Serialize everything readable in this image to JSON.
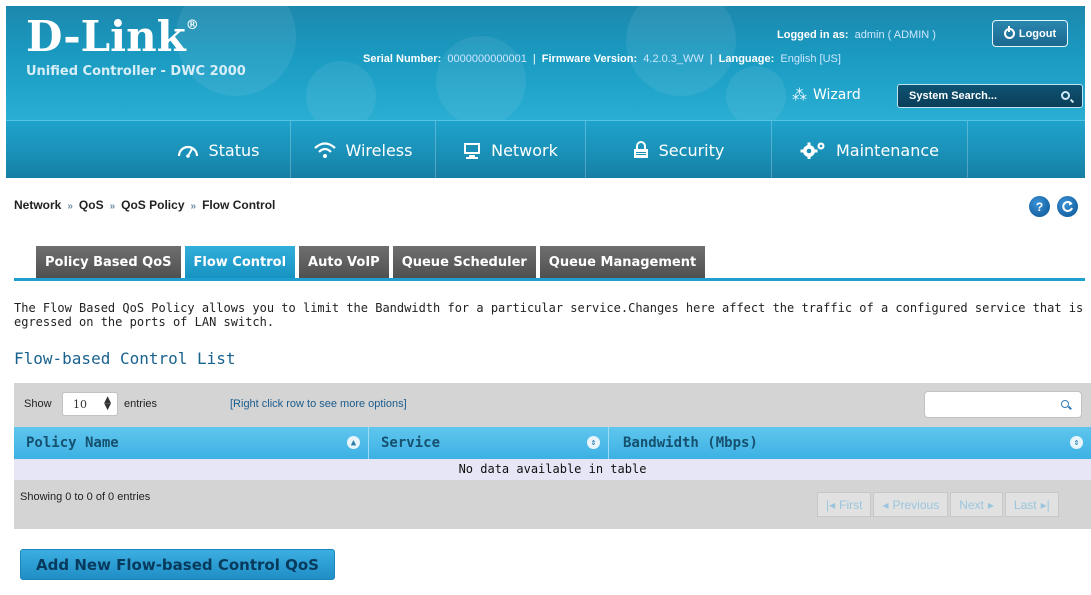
{
  "header": {
    "logo": "D-Link",
    "logo_mark": "®",
    "subtitle": "Unified Controller - DWC 2000",
    "logged_in_label": "Logged in as:",
    "logged_in_value": "admin ( ADMIN )",
    "logout_label": "Logout",
    "serial_label": "Serial Number:",
    "serial_value": "0000000000001",
    "firmware_label": "Firmware Version:",
    "firmware_value": "4.2.0.3_WW",
    "language_label": "Language:",
    "language_value": "English [US]",
    "wizard_label": "Wizard",
    "search_placeholder": "System Search..."
  },
  "nav": {
    "items": [
      {
        "label": "Status",
        "icon": "speedometer-icon"
      },
      {
        "label": "Wireless",
        "icon": "wifi-icon"
      },
      {
        "label": "Network",
        "icon": "monitor-icon"
      },
      {
        "label": "Security",
        "icon": "lock-icon"
      },
      {
        "label": "Maintenance",
        "icon": "gears-icon"
      }
    ]
  },
  "breadcrumb": {
    "items": [
      "Network",
      "QoS",
      "QoS Policy",
      "Flow Control"
    ],
    "separator": "»"
  },
  "tabs": [
    {
      "label": "Policy Based QoS",
      "active": false
    },
    {
      "label": "Flow Control",
      "active": true
    },
    {
      "label": "Auto VoIP",
      "active": false
    },
    {
      "label": "Queue Scheduler",
      "active": false
    },
    {
      "label": "Queue Management",
      "active": false
    }
  ],
  "description": "The Flow Based QoS Policy allows you to limit the Bandwidth for a particular service.Changes here affect the traffic of a configured service that is egressed on the ports of LAN switch.",
  "section_title": "Flow-based Control List",
  "table": {
    "show_label": "Show",
    "entries_value": "10",
    "entries_label": "entries",
    "hint": "[Right click row to see more options]",
    "columns": [
      "Policy Name",
      "Service",
      "Bandwidth (Mbps)"
    ],
    "empty_message": "No data available in table",
    "showing": "Showing 0 to 0 of 0 entries",
    "pager": {
      "first": "First",
      "previous": "Previous",
      "next": "Next",
      "last": "Last"
    }
  },
  "add_button": "Add New Flow-based Control QoS",
  "colors": {
    "header_blue": "#1a9bc2",
    "active_tab": "#1793c3",
    "inactive_tab": "#505050",
    "table_header": "#3cb1e4",
    "panel_gray": "#d4d4d4"
  }
}
